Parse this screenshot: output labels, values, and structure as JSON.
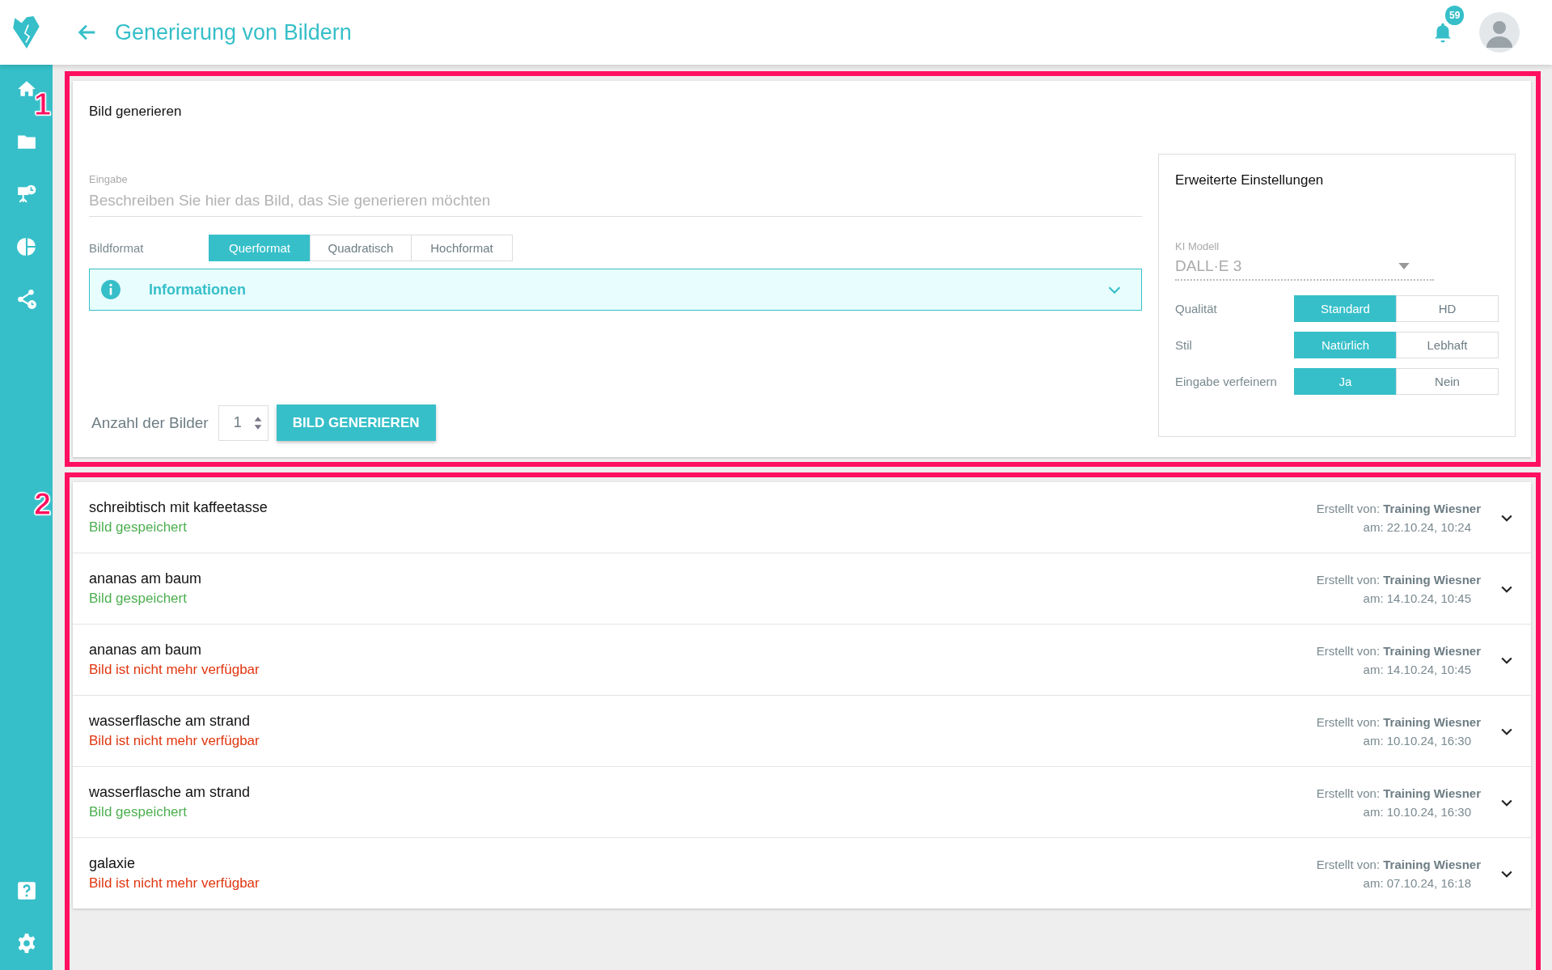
{
  "header": {
    "title": "Generierung von Bildern",
    "notification_count": "59"
  },
  "annotations": [
    {
      "label": "1"
    },
    {
      "label": "2"
    }
  ],
  "generator": {
    "title": "Bild generieren",
    "prompt": {
      "label": "Eingabe",
      "placeholder": "Beschreiben Sie hier das Bild, das Sie generieren möchten"
    },
    "format": {
      "label": "Bildformat",
      "options": [
        {
          "label": "Querformat",
          "selected": true
        },
        {
          "label": "Quadratisch",
          "selected": false
        },
        {
          "label": "Hochformat",
          "selected": false
        }
      ]
    },
    "info": {
      "label": "Informationen",
      "expanded": false
    },
    "count": {
      "label": "Anzahl der Bilder",
      "value": "1"
    },
    "submit": "BILD GENERIEREN",
    "advanced": {
      "title": "Erweiterte Einstellungen",
      "model": {
        "label": "KI Modell",
        "value": "DALL·E 3"
      },
      "settings": [
        {
          "label": "Qualität",
          "options": [
            {
              "label": "Standard",
              "selected": true
            },
            {
              "label": "HD",
              "selected": false
            }
          ]
        },
        {
          "label": "Stil",
          "options": [
            {
              "label": "Natürlich",
              "selected": true
            },
            {
              "label": "Lebhaft",
              "selected": false
            }
          ]
        },
        {
          "label": "Eingabe verfeinern",
          "options": [
            {
              "label": "Ja",
              "selected": true
            },
            {
              "label": "Nein",
              "selected": false
            }
          ]
        }
      ]
    }
  },
  "history": [
    {
      "title": "schreibtisch mit kaffeetasse",
      "status": {
        "text": "Bild gespeichert",
        "kind": "saved"
      },
      "created_by_label": "Erstellt von:",
      "created_by": "Training Wiesner",
      "date": "am: 22.10.24, 10:24",
      "expanded": false
    },
    {
      "title": "ananas am baum",
      "status": {
        "text": "Bild gespeichert",
        "kind": "saved"
      },
      "created_by_label": "Erstellt von:",
      "created_by": "Training Wiesner",
      "date": "am: 14.10.24, 10:45",
      "expanded": false
    },
    {
      "title": "ananas am baum",
      "status": {
        "text": "Bild ist nicht mehr verfügbar",
        "kind": "unavailable"
      },
      "created_by_label": "Erstellt von:",
      "created_by": "Training Wiesner",
      "date": "am: 14.10.24, 10:45",
      "expanded": false
    },
    {
      "title": "wasserflasche am strand",
      "status": {
        "text": "Bild ist nicht mehr verfügbar",
        "kind": "unavailable"
      },
      "created_by_label": "Erstellt von:",
      "created_by": "Training Wiesner",
      "date": "am: 10.10.24, 16:30",
      "expanded": false
    },
    {
      "title": "wasserflasche am strand",
      "status": {
        "text": "Bild gespeichert",
        "kind": "saved"
      },
      "created_by_label": "Erstellt von:",
      "created_by": "Training Wiesner",
      "date": "am: 10.10.24, 16:30",
      "expanded": false
    },
    {
      "title": "galaxie",
      "status": {
        "text": "Bild ist nicht mehr verfügbar",
        "kind": "unavailable"
      },
      "created_by_label": "Erstellt von:",
      "created_by": "Training Wiesner",
      "date": "am: 07.10.24, 16:18",
      "expanded": false
    }
  ]
}
